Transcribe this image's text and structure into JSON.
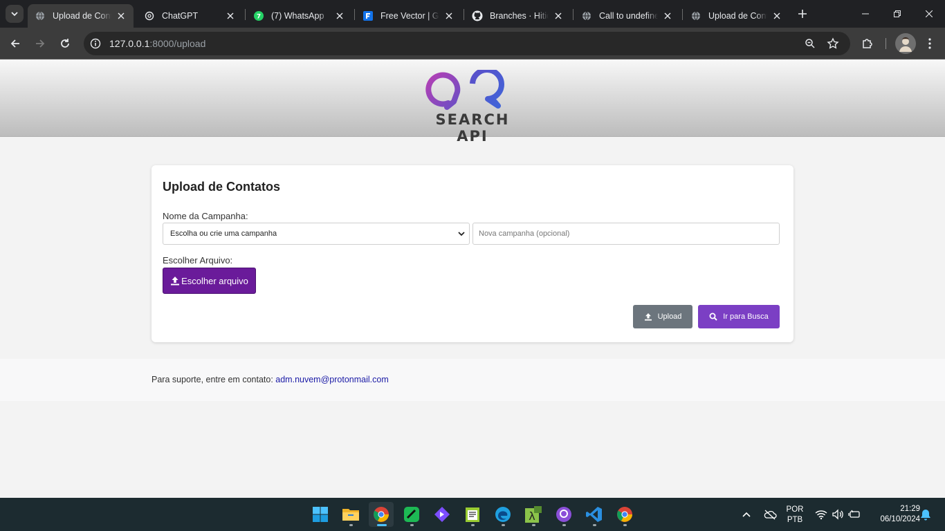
{
  "browser": {
    "tabs": [
      {
        "title": "Upload de Contatos",
        "active": true,
        "favicon": "globe-icon"
      },
      {
        "title": "ChatGPT",
        "active": false,
        "favicon": "chatgpt-icon"
      },
      {
        "title": "(7) WhatsApp",
        "active": false,
        "favicon": "whatsapp-icon"
      },
      {
        "title": "Free Vector | Graphic",
        "active": false,
        "favicon": "freepik-icon"
      },
      {
        "title": "Branches · Hiticon",
        "active": false,
        "favicon": "github-icon"
      },
      {
        "title": "Call to undefined",
        "active": false,
        "favicon": "globe-icon"
      },
      {
        "title": "Upload de Contatos",
        "active": false,
        "favicon": "globe-icon"
      }
    ],
    "url_host": "127.0.0.1",
    "url_rest": ":8000/upload"
  },
  "header": {
    "logo_text": "SEARCH API"
  },
  "form": {
    "title": "Upload de Contatos",
    "campaign_label": "Nome da Campanha:",
    "campaign_select_value": "Escolha ou crie uma campanha",
    "new_campaign_placeholder": "Nova campanha (opcional)",
    "file_label": "Escolher Arquivo:",
    "file_button_label": "Escolher arquivo",
    "upload_button_label": "Upload",
    "search_button_label": "Ir para Busca"
  },
  "footer": {
    "support_text": "Para suporte, entre em contato:",
    "support_email": "adm.nuvem@protonmail.com"
  },
  "taskbar": {
    "language": "POR",
    "layout": "PTB",
    "time": "21:29",
    "date": "06/10/2024"
  },
  "colors": {
    "primary_purple": "#6a1b9a",
    "search_button": "#7b3fc4",
    "upload_button": "#6c757d",
    "link": "#1a1aa6"
  }
}
